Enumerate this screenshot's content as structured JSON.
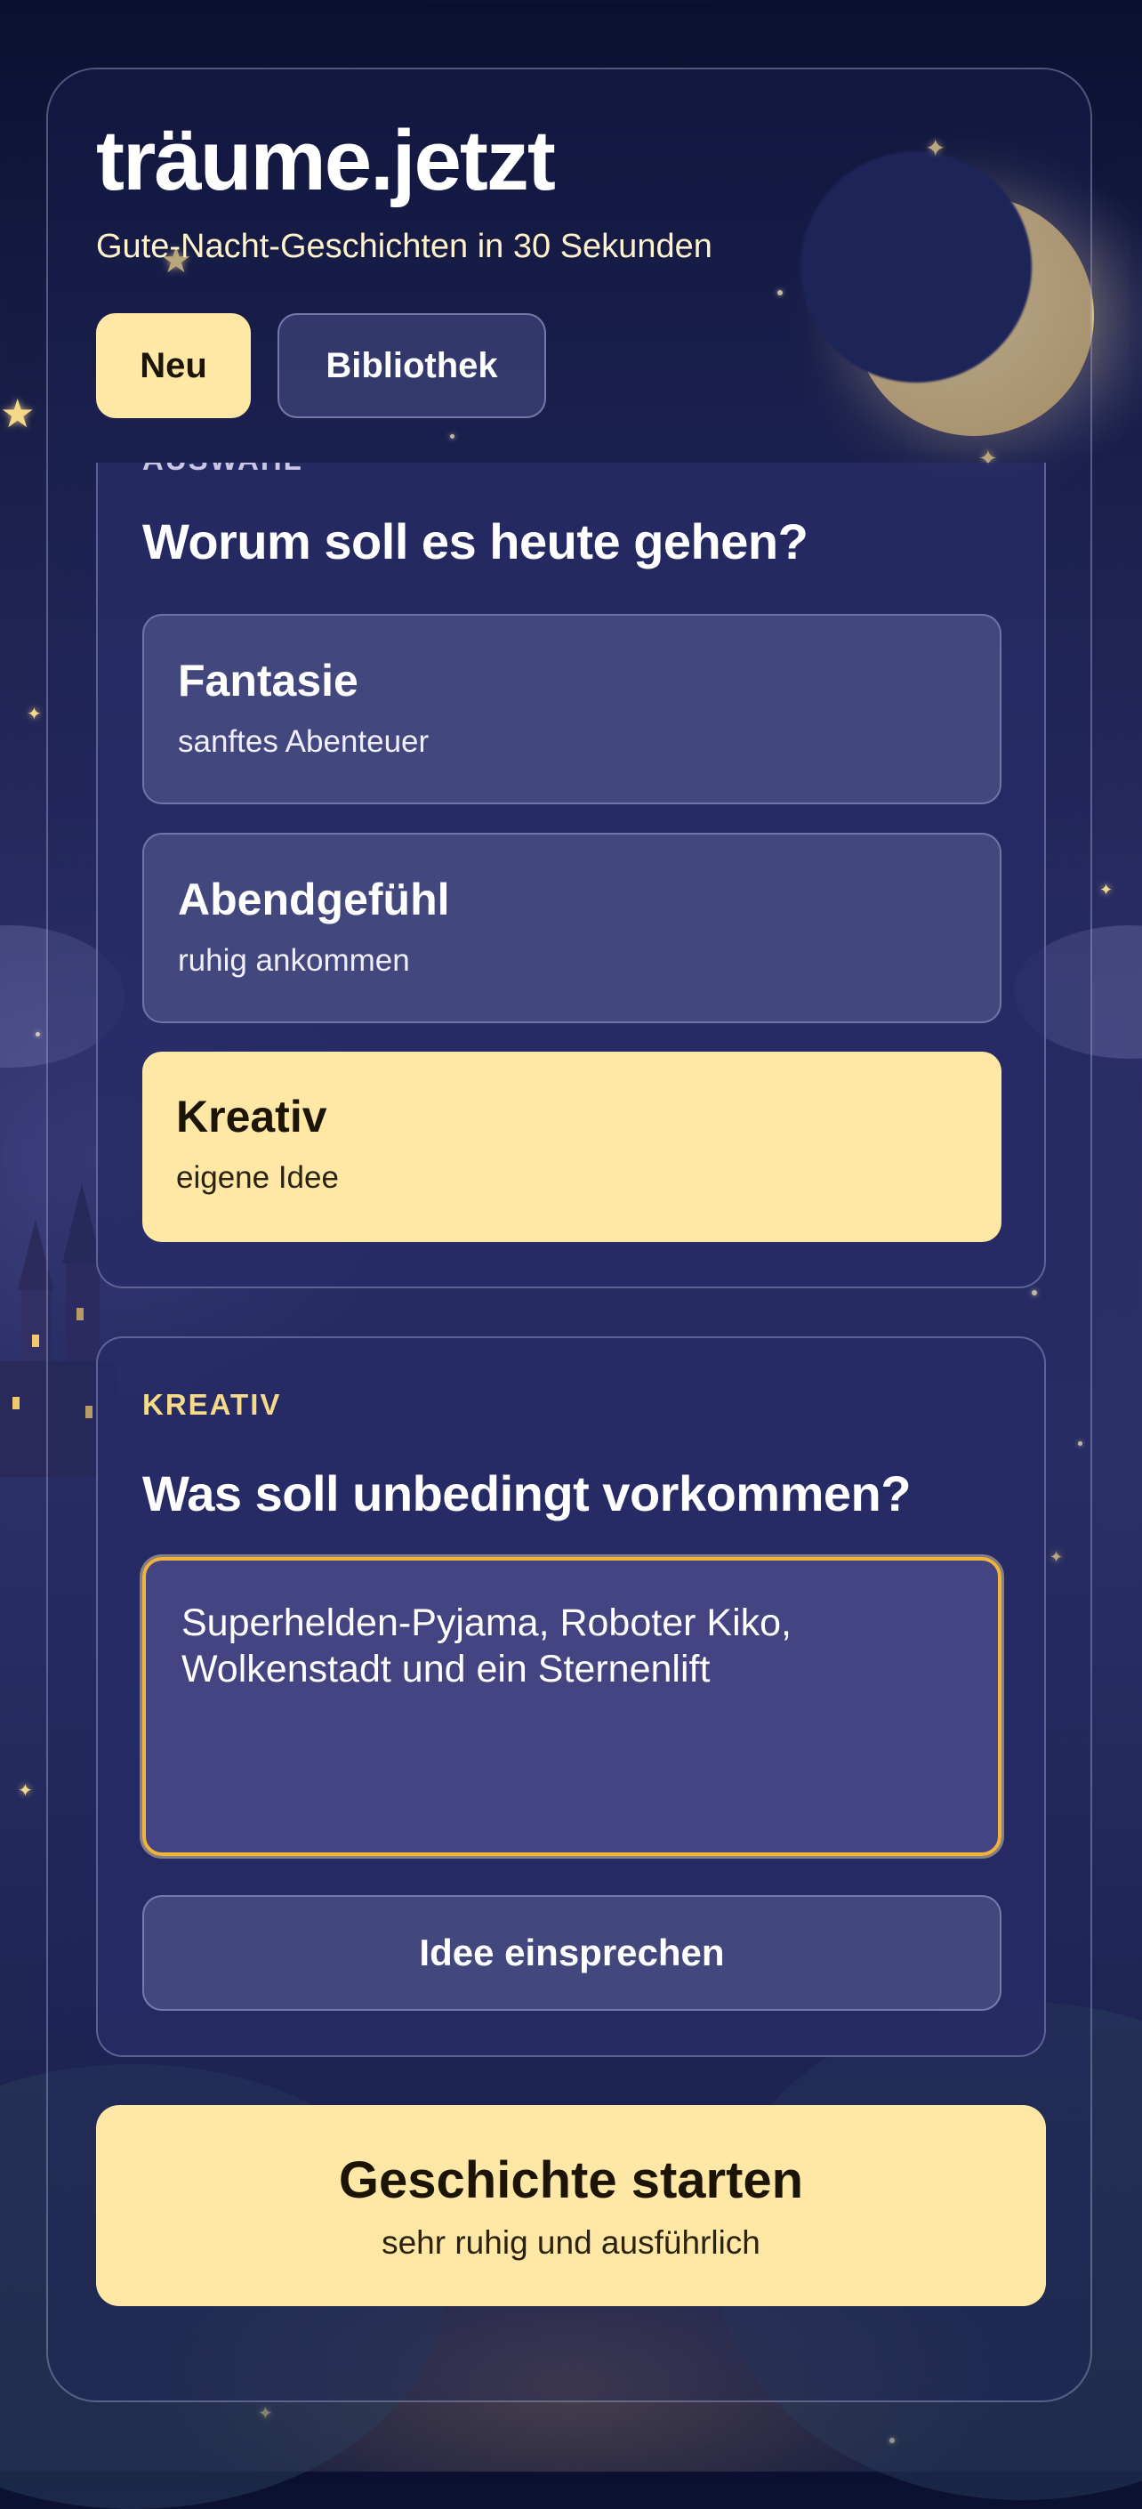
{
  "app": {
    "title": "träume.jetzt",
    "subtitle": "Gute-Nacht-Geschichten in 30 Sekunden"
  },
  "tabs": [
    {
      "label": "Neu",
      "active": true
    },
    {
      "label": "Bibliothek",
      "active": false
    }
  ],
  "choice_section": {
    "label": "AUSWAHL",
    "heading": "Worum soll es heute gehen?",
    "options": [
      {
        "title": "Fantasie",
        "subtitle": "sanftes Abenteuer",
        "selected": false
      },
      {
        "title": "Abendgefühl",
        "subtitle": "ruhig ankommen",
        "selected": false
      },
      {
        "title": "Kreativ",
        "subtitle": "eigene Idee",
        "selected": true
      }
    ]
  },
  "creative_section": {
    "label": "KREATIV",
    "heading": "Was soll unbedingt vorkommen?",
    "idea_value": "Superhelden-Pyjama, Roboter Kiko, Wolkenstadt und ein Sternenlift",
    "voice_button_label": "Idee einsprechen"
  },
  "start_button": {
    "label": "Geschichte starten",
    "subtitle": "sehr ruhig und ausführlich"
  },
  "colors": {
    "accent": "#ffe8a6",
    "focus_border": "#f0b43c",
    "section_label": "#f6d98a",
    "background": "#1a1f4a"
  },
  "icons": {
    "moon": "crescent-moon-icon",
    "star": "star-icon"
  }
}
